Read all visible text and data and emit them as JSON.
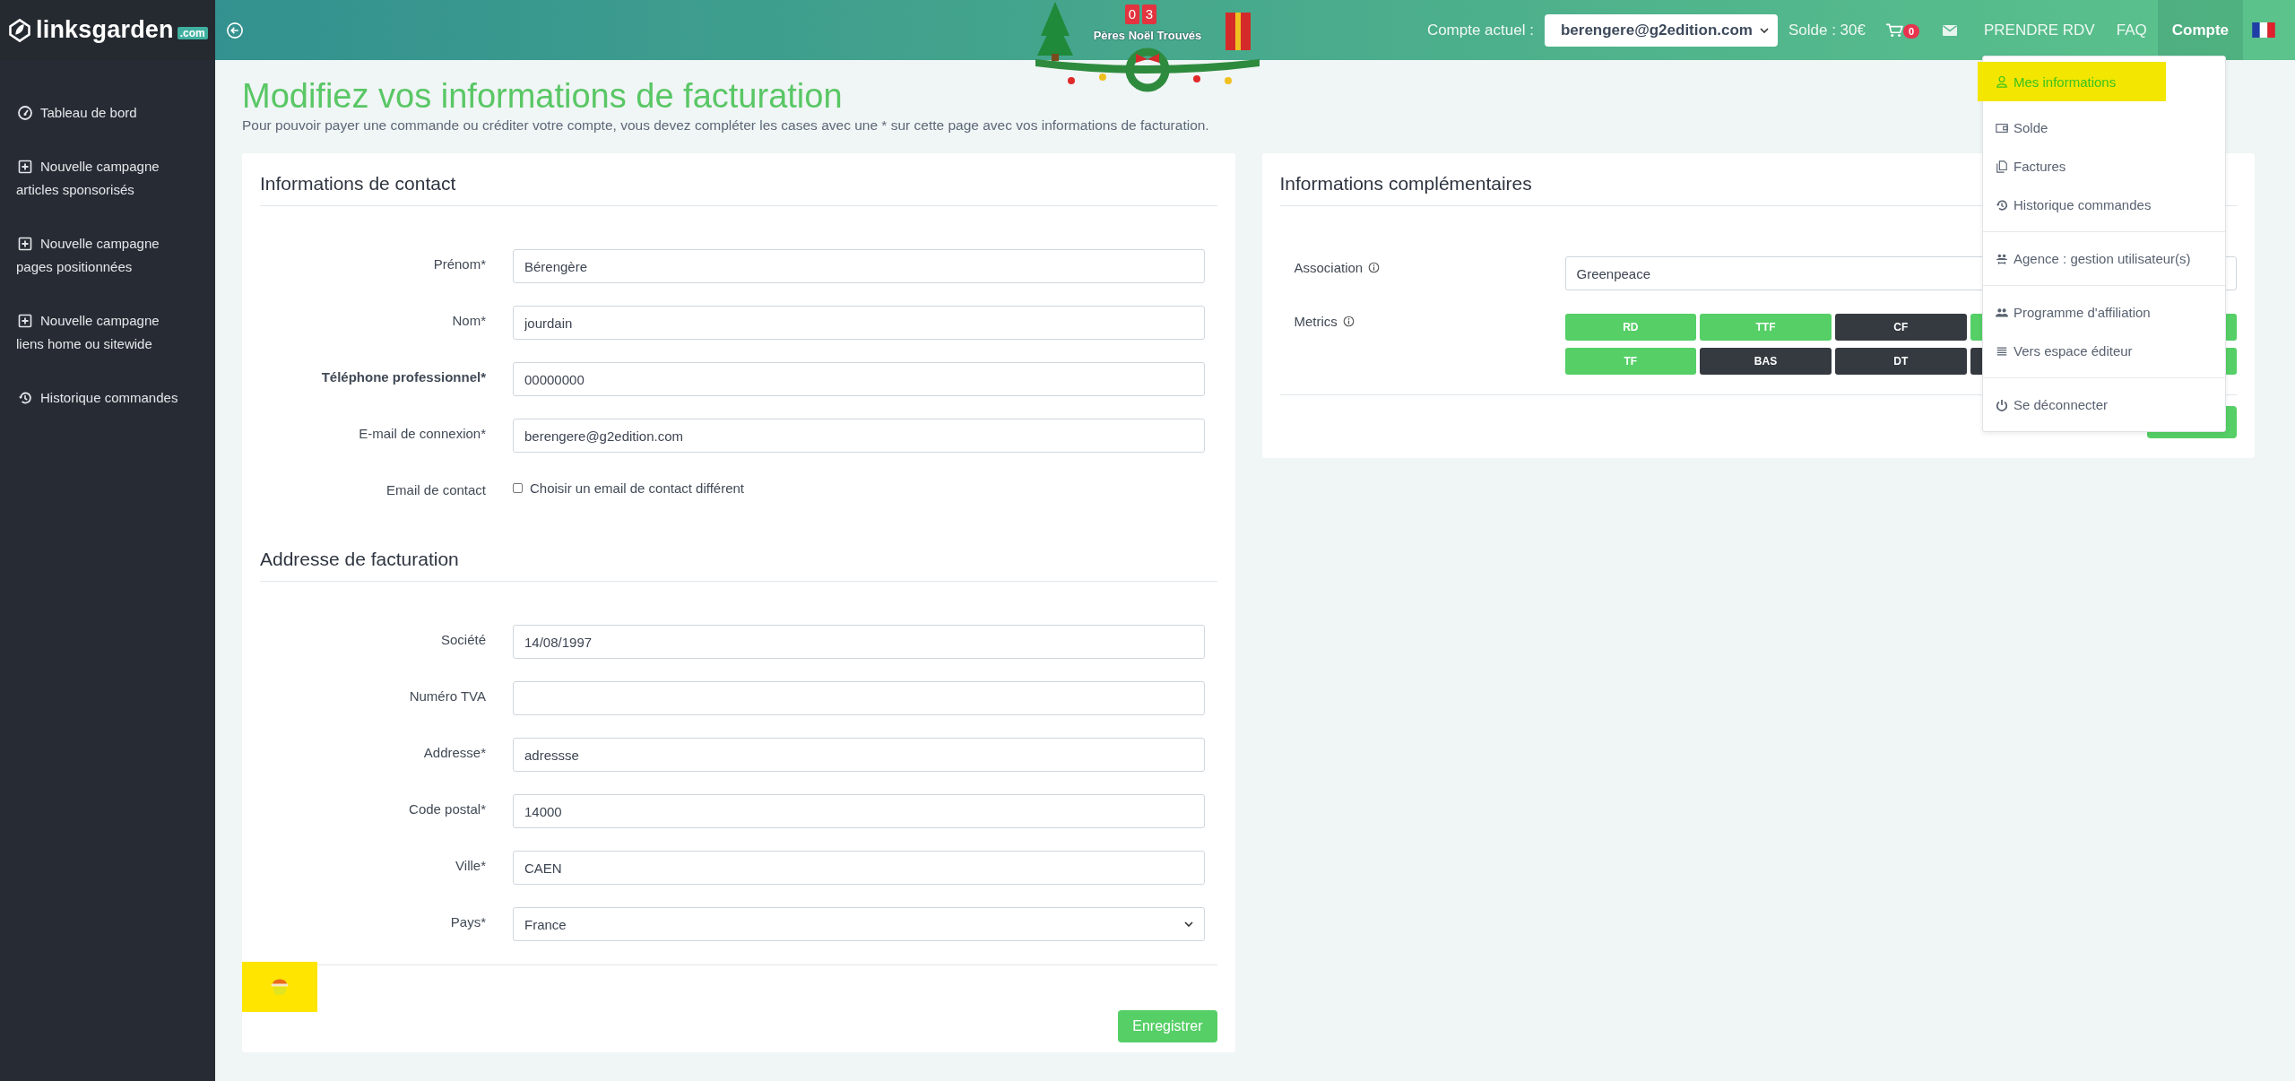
{
  "brand": {
    "name": "linksgarden",
    "tld": ".com"
  },
  "sidebar": {
    "items": [
      {
        "kind": "dashboard",
        "lines": [
          "Tableau de bord"
        ]
      },
      {
        "kind": "plus",
        "lines": [
          "Nouvelle campagne",
          "articles sponsorisés"
        ]
      },
      {
        "kind": "plus",
        "lines": [
          "Nouvelle campagne",
          "pages positionnées"
        ]
      },
      {
        "kind": "plus",
        "lines": [
          "Nouvelle campagne",
          "liens home ou sitewide"
        ]
      },
      {
        "kind": "history",
        "lines": [
          "Historique commandes"
        ]
      }
    ]
  },
  "banner": {
    "digits": [
      "0",
      "3"
    ],
    "caption": "Pères Noël Trouvés"
  },
  "topbar": {
    "account_label": "Compte actuel :",
    "account": "berengere@g2edition.com",
    "balance": "Solde : 30€",
    "cart_count": "0",
    "nav": [
      {
        "label": "PRENDRE RDV",
        "selected": false
      },
      {
        "label": "FAQ",
        "selected": false
      },
      {
        "label": "Compte",
        "selected": true
      }
    ]
  },
  "page": {
    "title": "Modifiez vos informations de facturation",
    "subtitle": "Pour pouvoir payer une commande ou créditer votre compte, vous devez compléter les cases avec une * sur cette page avec vos informations de facturation."
  },
  "contact": {
    "title": "Informations de contact",
    "fields": [
      {
        "kind": "text",
        "label": "Prénom*",
        "value": "Bérengère",
        "bold": false
      },
      {
        "kind": "text",
        "label": "Nom*",
        "value": "jourdain",
        "bold": false
      },
      {
        "kind": "text",
        "label": "Téléphone professionnel*",
        "value": "00000000",
        "bold": true
      },
      {
        "kind": "text",
        "label": "E-mail de connexion*",
        "value": "berengere@g2edition.com",
        "bold": false
      },
      {
        "kind": "checkbox",
        "label": "Email de contact",
        "option": "Choisir un email de contact différent",
        "checked": false,
        "bold": false
      }
    ]
  },
  "billing": {
    "title": "Addresse de facturation",
    "fields": [
      {
        "kind": "text",
        "label": "Société",
        "value": "14/08/1997",
        "bold": false
      },
      {
        "kind": "text",
        "label": "Numéro TVA",
        "bold": false
      },
      {
        "kind": "text",
        "label": "Addresse*",
        "value": "adressse",
        "bold": false
      },
      {
        "kind": "text",
        "label": "Code postal*",
        "value": "14000",
        "bold": false
      },
      {
        "kind": "text",
        "label": "Ville*",
        "value": "CAEN",
        "bold": false
      },
      {
        "kind": "select",
        "label": "Pays*",
        "value": "France",
        "bold": false
      }
    ]
  },
  "save_button": "Enregistrer",
  "extra": {
    "title": "Informations complémentaires",
    "association_label": "Association",
    "association": "Greenpeace",
    "metrics_label": "Metrics",
    "metrics": [
      {
        "label": "RD",
        "active": true
      },
      {
        "label": "TTF",
        "active": true
      },
      {
        "label": "CF",
        "active": false
      },
      {
        "active": true
      },
      {
        "active": true
      },
      {
        "label": "TF",
        "active": true
      },
      {
        "label": "BAS",
        "active": false
      },
      {
        "label": "DT",
        "active": false
      },
      {
        "active": false
      },
      {
        "active": true
      }
    ]
  },
  "account_menu": {
    "groups": [
      [
        {
          "kind": "user",
          "label": "Mes informations",
          "selected": true,
          "highlighted": true
        },
        {
          "kind": "wallet",
          "label": "Solde",
          "selected": false,
          "highlighted": false
        },
        {
          "kind": "files",
          "label": "Factures",
          "selected": false,
          "highlighted": false
        },
        {
          "kind": "history",
          "label": "Historique commandes",
          "selected": false,
          "highlighted": false
        }
      ],
      [
        {
          "kind": "group",
          "label": "Agence : gestion utilisateur(s)",
          "selected": false,
          "highlighted": false
        }
      ],
      [
        {
          "kind": "people",
          "label": "Programme d'affiliation",
          "selected": false,
          "highlighted": false
        },
        {
          "kind": "list",
          "label": "Vers espace éditeur",
          "selected": false,
          "highlighted": false
        }
      ],
      [
        {
          "kind": "power",
          "label": "Se déconnecter",
          "selected": false,
          "highlighted": false
        }
      ]
    ]
  },
  "santa_marker": {
    "highlighted": true
  }
}
